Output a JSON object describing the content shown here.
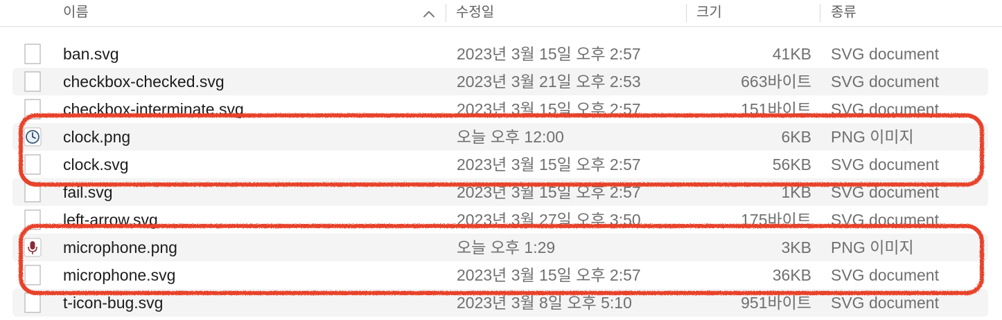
{
  "header": {
    "name_label": "이름",
    "date_label": "수정일",
    "size_label": "크기",
    "kind_label": "종류",
    "sort_direction": "ascending"
  },
  "files": [
    {
      "name": "ban.svg",
      "date": "2023년 3월 15일 오후 2:57",
      "size": "41KB",
      "kind": "SVG document",
      "icon": "document-icon"
    },
    {
      "name": "checkbox-checked.svg",
      "date": "2023년 3월 21일 오후 2:53",
      "size": "663바이트",
      "kind": "SVG document",
      "icon": "document-icon"
    },
    {
      "name": "checkbox-interminate.svg",
      "date": "2023년 3월 15일 오후 2:57",
      "size": "151바이트",
      "kind": "SVG document",
      "icon": "document-icon"
    },
    {
      "name": "clock.png",
      "date": "오늘 오후 12:00",
      "size": "6KB",
      "kind": "PNG 이미지",
      "icon": "clock-image-icon"
    },
    {
      "name": "clock.svg",
      "date": "2023년 3월 15일 오후 2:57",
      "size": "56KB",
      "kind": "SVG document",
      "icon": "document-icon"
    },
    {
      "name": "fail.svg",
      "date": "2023년 3월 15일 오후 2:57",
      "size": "1KB",
      "kind": "SVG document",
      "icon": "document-icon"
    },
    {
      "name": "left-arrow.svg",
      "date": "2023년 3월 27일 오후 3:50",
      "size": "175바이트",
      "kind": "SVG document",
      "icon": "document-icon"
    },
    {
      "name": "microphone.png",
      "date": "오늘 오후 1:29",
      "size": "3KB",
      "kind": "PNG 이미지",
      "icon": "microphone-image-icon"
    },
    {
      "name": "microphone.svg",
      "date": "2023년 3월 15일 오후 2:57",
      "size": "36KB",
      "kind": "SVG document",
      "icon": "document-icon"
    },
    {
      "name": "t-icon-bug.svg",
      "date": "2023년 3월 8일 오후 5:10",
      "size": "951바이트",
      "kind": "SVG document",
      "icon": "document-icon"
    }
  ],
  "highlight_color": "#e8432c"
}
